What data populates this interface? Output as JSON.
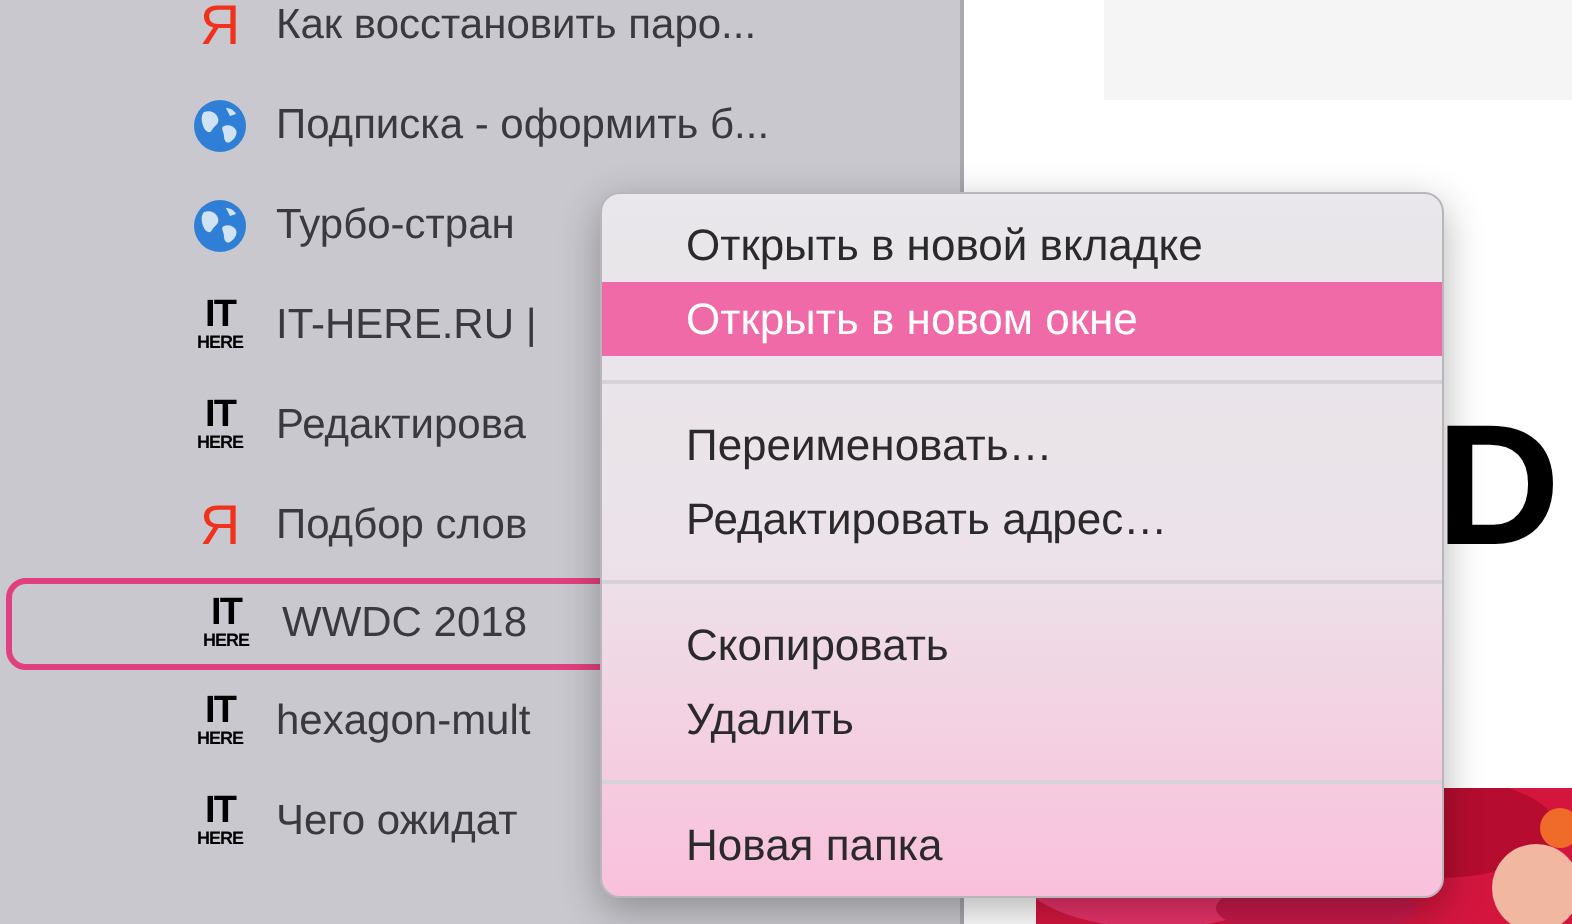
{
  "sidebar": {
    "items": [
      {
        "icon": {
          "kind": "letter",
          "text": "Я"
        },
        "title": "Как восстановить паро...",
        "selected": false
      },
      {
        "icon": {
          "kind": "globe"
        },
        "title": "Подписка - оформить б...",
        "selected": false
      },
      {
        "icon": {
          "kind": "globe"
        },
        "title": "Турбо-стран",
        "selected": false
      },
      {
        "icon": {
          "kind": "logo",
          "text": [
            "IT",
            "HERE"
          ]
        },
        "title": "IT-HERE.RU |",
        "selected": false
      },
      {
        "icon": {
          "kind": "logo",
          "text": [
            "IT",
            "HERE"
          ]
        },
        "title": "Редактирова",
        "selected": false
      },
      {
        "icon": {
          "kind": "letter",
          "text": "Я"
        },
        "title": "Подбор слов",
        "selected": false
      },
      {
        "icon": {
          "kind": "logo",
          "text": [
            "IT",
            "HERE"
          ]
        },
        "title": "WWDC 2018",
        "selected": true
      },
      {
        "icon": {
          "kind": "logo",
          "text": [
            "IT",
            "HERE"
          ]
        },
        "title": "hexagon-mult",
        "selected": false
      },
      {
        "icon": {
          "kind": "logo",
          "text": [
            "IT",
            "HERE"
          ]
        },
        "title": "Чего ожидат",
        "selected": false
      }
    ]
  },
  "content": {
    "heading": "D"
  },
  "context_menu": {
    "groups": [
      [
        {
          "label": "Открыть в новой вкладке",
          "selected": false
        },
        {
          "label": "Открыть в новом окне",
          "selected": true
        }
      ],
      [
        {
          "label": "Переименовать…",
          "selected": false
        },
        {
          "label": "Редактировать адрес…",
          "selected": false
        }
      ],
      [
        {
          "label": "Скопировать",
          "selected": false
        },
        {
          "label": "Удалить",
          "selected": false
        }
      ],
      [
        {
          "label": "Новая папка",
          "selected": false
        }
      ]
    ]
  }
}
